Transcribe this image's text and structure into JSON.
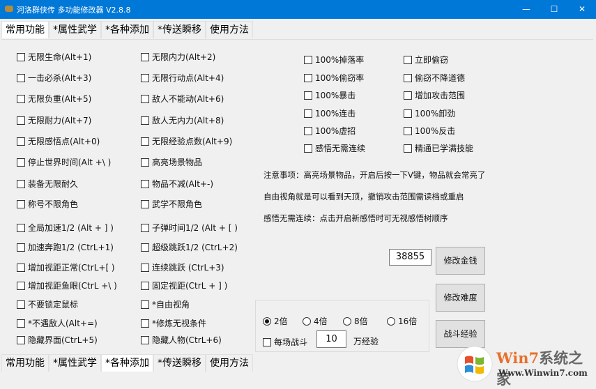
{
  "window": {
    "title": "河洛群侠传 多功能修改器  V2.8.8",
    "minimize": "—",
    "maximize": "☐",
    "close": "✕"
  },
  "tabs": [
    {
      "label": "常用功能"
    },
    {
      "label": "*属性武学"
    },
    {
      "label": "*各种添加"
    },
    {
      "label": "*传送瞬移"
    },
    {
      "label": "使用方法"
    }
  ],
  "left_col1": [
    "无限生命(Alt+1)",
    "一击必杀(Alt+3)",
    "无限负重(Alt+5)",
    "无限耐力(Alt+7)",
    "无限感悟点(Alt+0)",
    "停止世界时间(Alt  +\\ )",
    "装备无限耐久",
    "称号不限角色",
    "全局加速1/2 (Alt + ] )",
    "加速奔跑1/2 (CtrL+1)",
    "增加视距正常(CtrL+[ )",
    "增加视距鱼眼(CtrL  +\\ )",
    "不要锁定鼠标",
    "*不遇敌人(Alt+=)",
    "隐藏界面(CtrL+5)"
  ],
  "left_col2": [
    "无限内力(Alt+2)",
    "无限行动点(Alt+4)",
    "敌人不能动(Alt+6)",
    "敌人无内力(Alt+8)",
    "无限经验点数(Alt+9)",
    "高亮场景物品",
    "物品不减(Alt+-)",
    "武学不限角色",
    "子弹时间1/2 (Alt + [ )",
    "超级跳跃1/2 (CtrL+2)",
    "连续跳跃 (CtrL+3)",
    "固定视距(CtrL + ] )",
    "*自由视角",
    "*修炼无视条件",
    "隐藏人物(CtrL+6)"
  ],
  "right_col1": [
    "100%掉落率",
    "100%偷窃率",
    "100%暴击",
    "100%连击",
    "100%虚招",
    "感悟无需连续"
  ],
  "right_col2": [
    "立即偷窃",
    "偷窃不降道德",
    "增加攻击范围",
    "100%卸劲",
    "100%反击",
    "精通已学满技能"
  ],
  "notes": [
    "注意事项：高亮场景物品，开启后按一下V键，物品就会常亮了",
    "自由视角就是可以看到天顶，撤销攻击范围需读档或重启",
    "感悟无需连续：点击开启新感悟时可无视感悟树顺序"
  ],
  "money": {
    "value": "38855",
    "button": "修改金钱"
  },
  "difficulty_button": "修改难度",
  "exp": {
    "radios": [
      "2倍",
      "4倍",
      "8倍",
      "16倍"
    ],
    "selected": "2倍",
    "checkbox": "每场战斗",
    "value": "10",
    "unit": "万经验",
    "button": "战斗经验"
  },
  "watermark": {
    "brand": "Win7系统之家",
    "url": "Www.Winwin7.com"
  }
}
